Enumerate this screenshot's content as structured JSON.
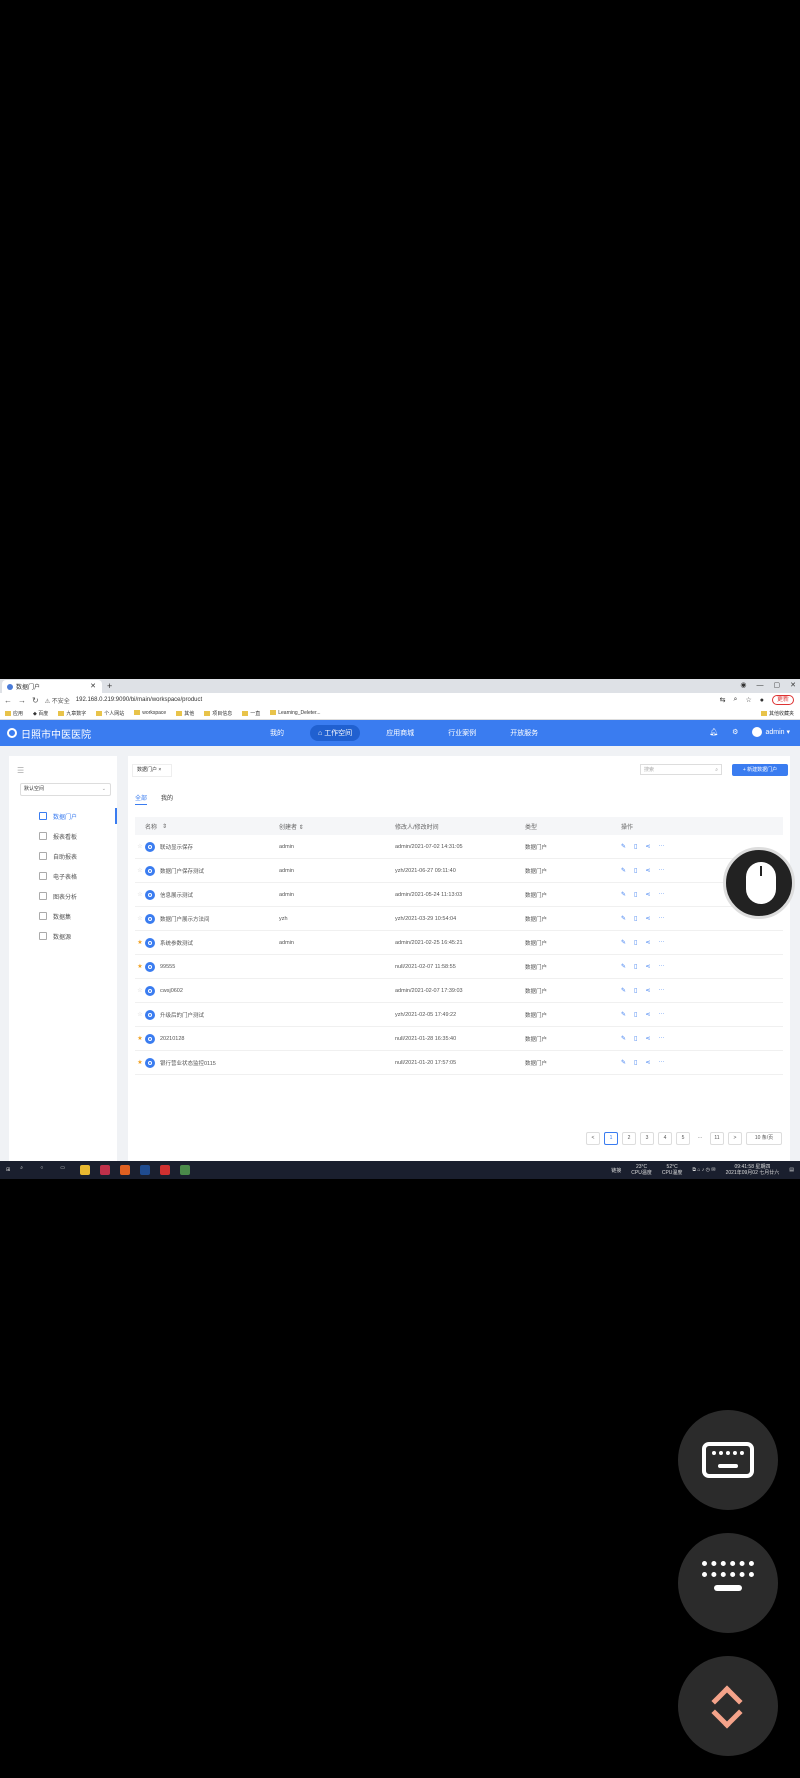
{
  "browser": {
    "tab_title": "数据门户",
    "new_tab": "+",
    "window_controls": [
      "◉",
      "—",
      "▢",
      "✕"
    ],
    "insecure_label": "不安全",
    "url": "192.168.0.219:9090/bi/main/workspace/product",
    "update_label": "更新",
    "bookmarks": [
      "应用",
      "百度",
      "九章数字",
      "个人网站",
      "workspace",
      "其他",
      "项目信息",
      "一直",
      "Learning_Deleter..."
    ],
    "bookmarks_right": "其他收藏夹"
  },
  "app": {
    "title": "日照市中医医院",
    "nav": [
      "我的",
      "工作空间",
      "应用商城",
      "行业案例",
      "开放服务"
    ],
    "nav_active": "工作空间",
    "user": "admin"
  },
  "sidebar": {
    "workspace_select": "默认空间",
    "items": [
      {
        "label": "数据门户",
        "active": true
      },
      {
        "label": "报表看板"
      },
      {
        "label": "自助报表"
      },
      {
        "label": "电子表格"
      },
      {
        "label": "图表分析"
      },
      {
        "label": "数据集"
      },
      {
        "label": "数据源"
      }
    ]
  },
  "main": {
    "breadcrumb": "数据门户",
    "search_placeholder": "搜索",
    "add_button": "新建数据门户",
    "tabs": [
      "全部",
      "我的"
    ],
    "columns": [
      "名称",
      "创建者",
      "修改人/修改时间",
      "类型",
      "操作"
    ],
    "rows": [
      {
        "star": false,
        "name": "联动显示保存",
        "creator": "admin",
        "modified": "admin/2021-07-02 14:31:05",
        "type": "数据门户"
      },
      {
        "star": false,
        "name": "数据门户保存测试",
        "creator": "admin",
        "modified": "yzh/2021-06-27 09:11:40",
        "type": "数据门户"
      },
      {
        "star": false,
        "name": "信息展示测试",
        "creator": "admin",
        "modified": "admin/2021-05-24 11:13:03",
        "type": "数据门户"
      },
      {
        "star": false,
        "name": "数据门户展示方法间",
        "creator": "yzh",
        "modified": "yzh/2021-03-29 10:54:04",
        "type": "数据门户"
      },
      {
        "star": true,
        "name": "系统参数测试",
        "creator": "admin",
        "modified": "admin/2021-02-25 16:45:21",
        "type": "数据门户"
      },
      {
        "star": true,
        "name": "99555",
        "creator": "",
        "modified": "null/2021-02-07 11:58:55",
        "type": "数据门户"
      },
      {
        "star": false,
        "name": "cwsj0602",
        "creator": "",
        "modified": "admin/2021-02-07 17:39:03",
        "type": "数据门户"
      },
      {
        "star": false,
        "name": "升级后的门户测试",
        "creator": "",
        "modified": "yzh/2021-02-05 17:49:22",
        "type": "数据门户"
      },
      {
        "star": true,
        "name": "20210128",
        "creator": "",
        "modified": "null/2021-01-28 16:35:40",
        "type": "数据门户"
      },
      {
        "star": true,
        "name": "银行营业状态监控0115",
        "creator": "",
        "modified": "null/2021-01-20 17:57:05",
        "type": "数据门户"
      }
    ],
    "ops_icons": [
      "✎",
      "▯",
      "⋖",
      "···"
    ],
    "pagination": {
      "prev": "<",
      "pages": [
        "1",
        "2",
        "3",
        "4",
        "5",
        "···",
        "11"
      ],
      "next": ">",
      "page_size": "10 条/页"
    }
  },
  "taskbar": {
    "temp1": "23°C",
    "temp1_label": "CPU温度",
    "temp2": "52°C",
    "temp2_label": "CPU温度",
    "weather": "链接",
    "time": "09:41:58 星期四",
    "date": "2021年09月02 七月廿六"
  },
  "colors": {
    "brand": "#3a7cf0",
    "star": "#f0a020",
    "overlay_accent": "#f4a38a"
  }
}
